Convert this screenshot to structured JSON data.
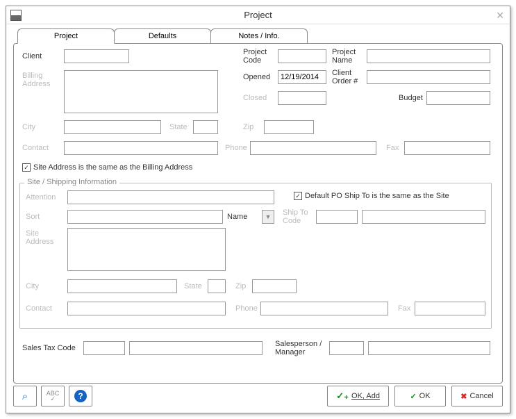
{
  "window": {
    "title": "Project"
  },
  "tabs": [
    {
      "label": "Project"
    },
    {
      "label": "Defaults"
    },
    {
      "label": "Notes / Info."
    }
  ],
  "labels": {
    "client": "Client",
    "billing_address": "Billing Address",
    "city": "City",
    "state": "State",
    "contact": "Contact",
    "phone": "Phone",
    "fax": "Fax",
    "project_code": "Project Code",
    "project_name": "Project Name",
    "opened": "Opened",
    "client_order": "Client Order #",
    "closed": "Closed",
    "budget": "Budget",
    "zip": "Zip",
    "same_address": "Site Address is the same as the Billing Address",
    "group_title": "Site / Shipping Information",
    "attention": "Attention",
    "sort": "Sort",
    "name": "Name",
    "site_address": "Site Address",
    "default_po": "Default PO Ship To is the same as the Site",
    "ship_to_code": "Ship To Code",
    "sales_tax_code": "Sales Tax Code",
    "salesperson_manager": "Salesperson / Manager"
  },
  "values": {
    "client": "",
    "billing_address": "",
    "city": "",
    "state": "",
    "contact": "",
    "phone": "",
    "fax": "",
    "project_code": "",
    "project_name": "",
    "opened": "12/19/2014",
    "client_order": "",
    "closed": "",
    "budget": "",
    "zip": "",
    "same_address_checked": "✓",
    "attention": "",
    "sort": "",
    "site_address": "",
    "default_po_checked": "✓",
    "ship_to_code_a": "",
    "ship_to_code_b": "",
    "site_city": "",
    "site_state": "",
    "site_zip": "",
    "site_contact": "",
    "site_phone": "",
    "site_fax": "",
    "tax_code_a": "",
    "tax_code_b": "",
    "salesperson_a": "",
    "salesperson_b": ""
  },
  "footer": {
    "ok_add": "OK, Add",
    "ok": "OK",
    "cancel": "Cancel"
  }
}
